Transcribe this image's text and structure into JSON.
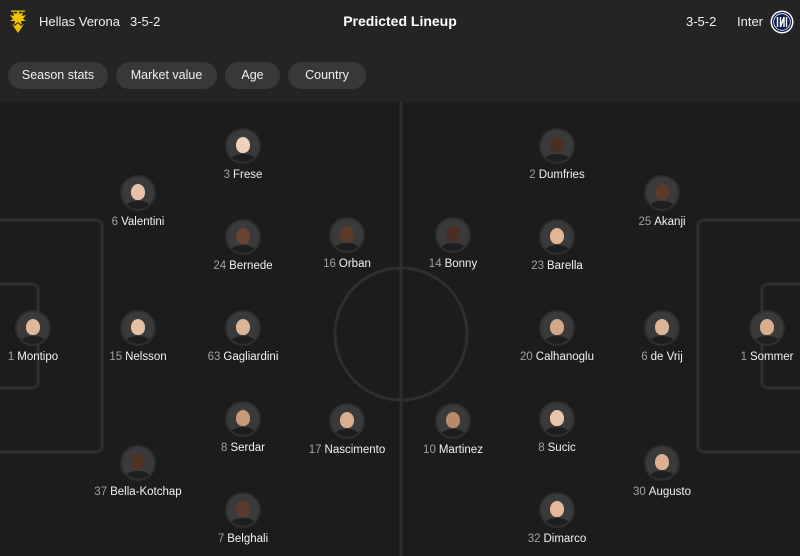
{
  "header": {
    "home_team": "Hellas Verona",
    "home_formation": "3-5-2",
    "title": "Predicted Lineup",
    "away_formation": "3-5-2",
    "away_team": "Inter"
  },
  "filters": [
    "Season stats",
    "Market value",
    "Age",
    "Country"
  ],
  "home_players": [
    {
      "number": "3",
      "name": "Frese",
      "skin": "#f0d0b8"
    },
    {
      "number": "6",
      "name": "Valentini",
      "skin": "#e8c2a8"
    },
    {
      "number": "24",
      "name": "Bernede",
      "skin": "#6a4330"
    },
    {
      "number": "16",
      "name": "Orban",
      "skin": "#5a3a28"
    },
    {
      "number": "1",
      "name": "Montipo",
      "skin": "#e0b89a"
    },
    {
      "number": "15",
      "name": "Nelsson",
      "skin": "#e4c0a4"
    },
    {
      "number": "63",
      "name": "Gagliardini",
      "skin": "#dcb496"
    },
    {
      "number": "8",
      "name": "Serdar",
      "skin": "#c89a7a"
    },
    {
      "number": "17",
      "name": "Nascimento",
      "skin": "#d8b090"
    },
    {
      "number": "37",
      "name": "Bella-Kotchap",
      "skin": "#4e3224"
    },
    {
      "number": "7",
      "name": "Belghali",
      "skin": "#5c3a2a"
    }
  ],
  "away_players": [
    {
      "number": "2",
      "name": "Dumfries",
      "skin": "#4a2e22"
    },
    {
      "number": "25",
      "name": "Akanji",
      "skin": "#5a3a2a"
    },
    {
      "number": "14",
      "name": "Bonny",
      "skin": "#4a2e22"
    },
    {
      "number": "23",
      "name": "Barella",
      "skin": "#e0b696"
    },
    {
      "number": "20",
      "name": "Calhanoglu",
      "skin": "#d4a886"
    },
    {
      "number": "6",
      "name": "de Vrij",
      "skin": "#dcb496"
    },
    {
      "number": "1",
      "name": "Sommer",
      "skin": "#d8ae8e"
    },
    {
      "number": "10",
      "name": "Martinez",
      "skin": "#b88a6a"
    },
    {
      "number": "8",
      "name": "Sucic",
      "skin": "#e8c4a8"
    },
    {
      "number": "30",
      "name": "Augusto",
      "skin": "#dcb090"
    },
    {
      "number": "32",
      "name": "Dimarco",
      "skin": "#e4b898"
    }
  ],
  "colors": {
    "background": "#1c1c1c",
    "header": "#242424",
    "chip": "#383838",
    "pitch_lines": "#2e2e2e",
    "verona_yellow": "#f2c300",
    "inter_navy": "#0b1a4a"
  }
}
